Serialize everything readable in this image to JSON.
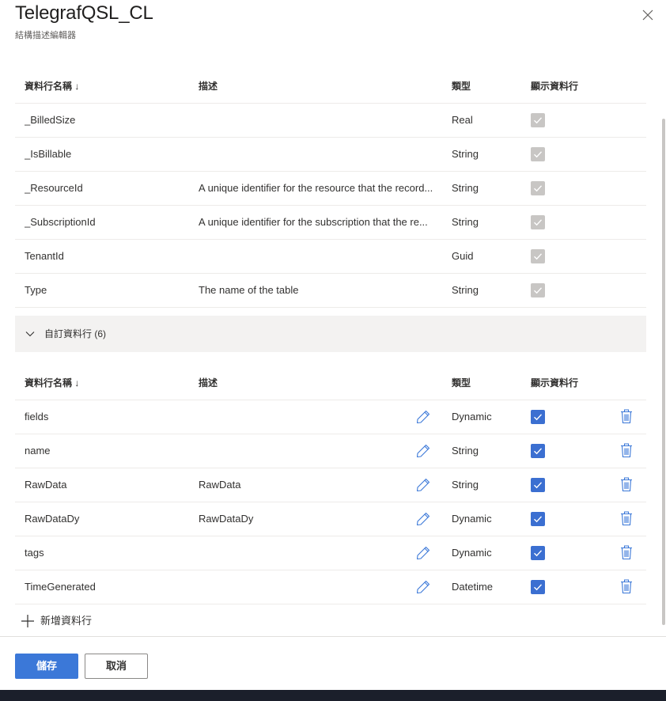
{
  "header": {
    "title": "TelegrafQSL_CL",
    "subtitle": "結構描述編輯器"
  },
  "columns": {
    "name": "資料行名稱 ↓",
    "description": "描述",
    "type": "類型",
    "show": "顯示資料行"
  },
  "standard_rows": [
    {
      "name": "_BilledSize",
      "description": "",
      "type": "Real",
      "shown": true
    },
    {
      "name": "_IsBillable",
      "description": "",
      "type": "String",
      "shown": true
    },
    {
      "name": "_ResourceId",
      "description": "A unique identifier for the resource that the record...",
      "type": "String",
      "shown": true
    },
    {
      "name": "_SubscriptionId",
      "description": "A unique identifier for the subscription that the re...",
      "type": "String",
      "shown": true
    },
    {
      "name": "TenantId",
      "description": "",
      "type": "Guid",
      "shown": true
    },
    {
      "name": "Type",
      "description": "The name of the table",
      "type": "String",
      "shown": true
    }
  ],
  "custom_group": {
    "label": "自訂資料行 (6)",
    "expanded": true
  },
  "custom_rows": [
    {
      "name": "fields",
      "description": "",
      "type": "Dynamic",
      "shown": true
    },
    {
      "name": "name",
      "description": "",
      "type": "String",
      "shown": true
    },
    {
      "name": "RawData",
      "description": "RawData",
      "type": "String",
      "shown": true
    },
    {
      "name": "RawDataDy",
      "description": "RawDataDy",
      "type": "Dynamic",
      "shown": true
    },
    {
      "name": "tags",
      "description": "",
      "type": "Dynamic",
      "shown": true
    },
    {
      "name": "TimeGenerated",
      "description": "",
      "type": "Datetime",
      "shown": true
    }
  ],
  "add_column_label": "新增資料行",
  "footer": {
    "save_label": "儲存",
    "cancel_label": "取消"
  },
  "colors": {
    "accent": "#3b78d8",
    "checkbox_checked": "#3b6fd1",
    "checkbox_disabled": "#c8c6c4",
    "group_bg": "#f3f2f1"
  },
  "icons": {
    "close": "close-icon",
    "chevron": "chevron-down-icon",
    "edit": "pencil-icon",
    "delete": "trash-icon",
    "add": "plus-icon",
    "check": "checkmark-icon"
  }
}
